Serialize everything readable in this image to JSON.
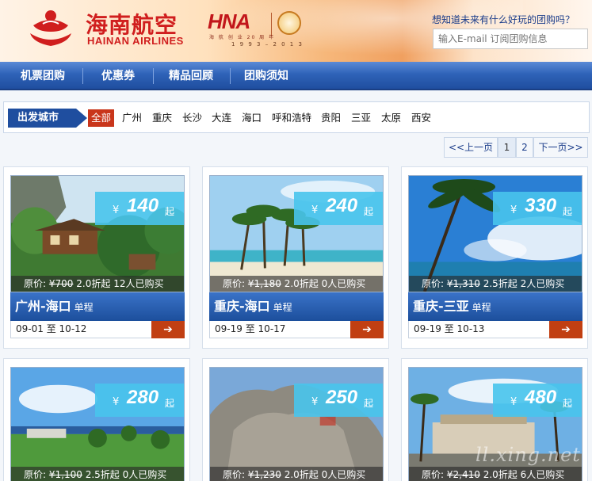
{
  "header": {
    "brand_cn": "海南航空",
    "brand_en": "HAINAN AIRLINES",
    "hna_logo_text": "HNA",
    "hna_subtitle": "海 航 创 业 20 周 年",
    "hna_years": "1 9 9 3 – 2 0 1 3",
    "promo_question": "想知道未来有什么好玩的团购吗？",
    "email_placeholder": "输入E-mail 订阅团购信息",
    "brand_color": "#d01e1e"
  },
  "nav": {
    "items": [
      "机票团购",
      "优惠券",
      "精品回顾",
      "团购须知"
    ]
  },
  "city_filter": {
    "label": "出发城市",
    "cities": [
      "全部",
      "广州",
      "重庆",
      "长沙",
      "大连",
      "海口",
      "呼和浩特",
      "贵阳",
      "三亚",
      "太原",
      "西安"
    ],
    "active": "全部"
  },
  "pagination": {
    "prev": "<<上一页",
    "pages": [
      "1",
      "2"
    ],
    "current": "1",
    "next": "下一页>>"
  },
  "common": {
    "yen": "¥",
    "qi": "起",
    "trip_type": "单程",
    "arrow": "➔",
    "orig_label": "原价:",
    "to": "至",
    "bought_suffix": "人已购买",
    "discount_suffix": "折起"
  },
  "deals": [
    {
      "price": "140",
      "orig_price": "¥700",
      "discount": "2.0",
      "bought": "12",
      "route": "广州-海口",
      "start": "09-01",
      "end": "10-12",
      "scene": "treehouse"
    },
    {
      "price": "240",
      "orig_price": "¥1,180",
      "discount": "2.0",
      "bought": "0",
      "route": "重庆-海口",
      "start": "09-19",
      "end": "10-17",
      "scene": "beach-palms"
    },
    {
      "price": "330",
      "orig_price": "¥1,310",
      "discount": "2.5",
      "bought": "2",
      "route": "重庆-三亚",
      "start": "09-19",
      "end": "10-13",
      "scene": "sea-palm"
    },
    {
      "price": "280",
      "orig_price": "¥1,100",
      "discount": "2.5",
      "bought": "0",
      "route": "",
      "start": "",
      "end": "",
      "scene": "golf"
    },
    {
      "price": "250",
      "orig_price": "¥1,230",
      "discount": "2.0",
      "bought": "0",
      "route": "",
      "start": "",
      "end": "",
      "scene": "rock"
    },
    {
      "price": "480",
      "orig_price": "¥2,410",
      "discount": "2.0",
      "bought": "6",
      "route": "",
      "start": "",
      "end": "",
      "scene": "resort"
    }
  ],
  "watermark": "ll.xing.net"
}
